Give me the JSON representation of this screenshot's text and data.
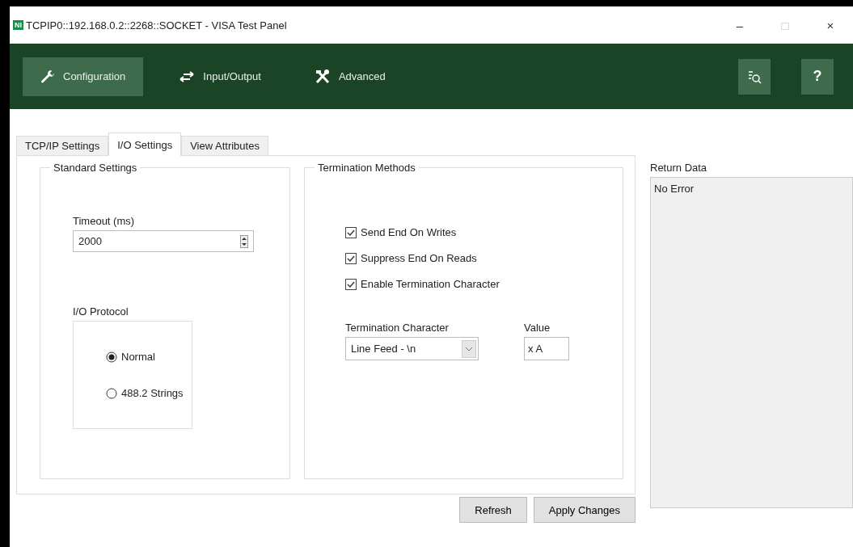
{
  "window": {
    "title": "TCPIP0::192.168.0.2::2268::SOCKET - VISA Test Panel",
    "logo": "NI",
    "controls": [
      "–",
      "□",
      "×"
    ]
  },
  "toolbar": {
    "items": [
      {
        "label": "Configuration",
        "selected": true
      },
      {
        "label": "Input/Output",
        "selected": false
      },
      {
        "label": "Advanced",
        "selected": false
      }
    ],
    "right_buttons": [
      {
        "kind": "icon"
      },
      {
        "kind": "text",
        "text": "?"
      }
    ]
  },
  "tabs": [
    {
      "label": "TCP/IP Settings",
      "selected": false
    },
    {
      "label": "I/O Settings",
      "selected": true
    },
    {
      "label": "View Attributes",
      "selected": false
    }
  ],
  "standard_settings": {
    "title": "Standard Settings",
    "timeout": {
      "label": "Timeout (ms)",
      "value": "2000"
    },
    "protocol": {
      "label": "I/O Protocol",
      "options": [
        {
          "label": "Normal",
          "selected": true
        },
        {
          "label": "488.2 Strings",
          "selected": false
        }
      ]
    }
  },
  "termination": {
    "title": "Termination Methods",
    "checkboxes": [
      {
        "label": "Send End On Writes",
        "checked": true
      },
      {
        "label": "Suppress End On Reads",
        "checked": true
      },
      {
        "label": "Enable Termination Character",
        "checked": true
      }
    ],
    "character": {
      "label": "Termination Character",
      "value": "Line Feed - \\n"
    },
    "value": {
      "label": "Value",
      "value": "x A"
    }
  },
  "return_data": {
    "label": "Return Data",
    "text": "No Error"
  },
  "buttons": [
    "Refresh",
    "Apply Changes"
  ]
}
